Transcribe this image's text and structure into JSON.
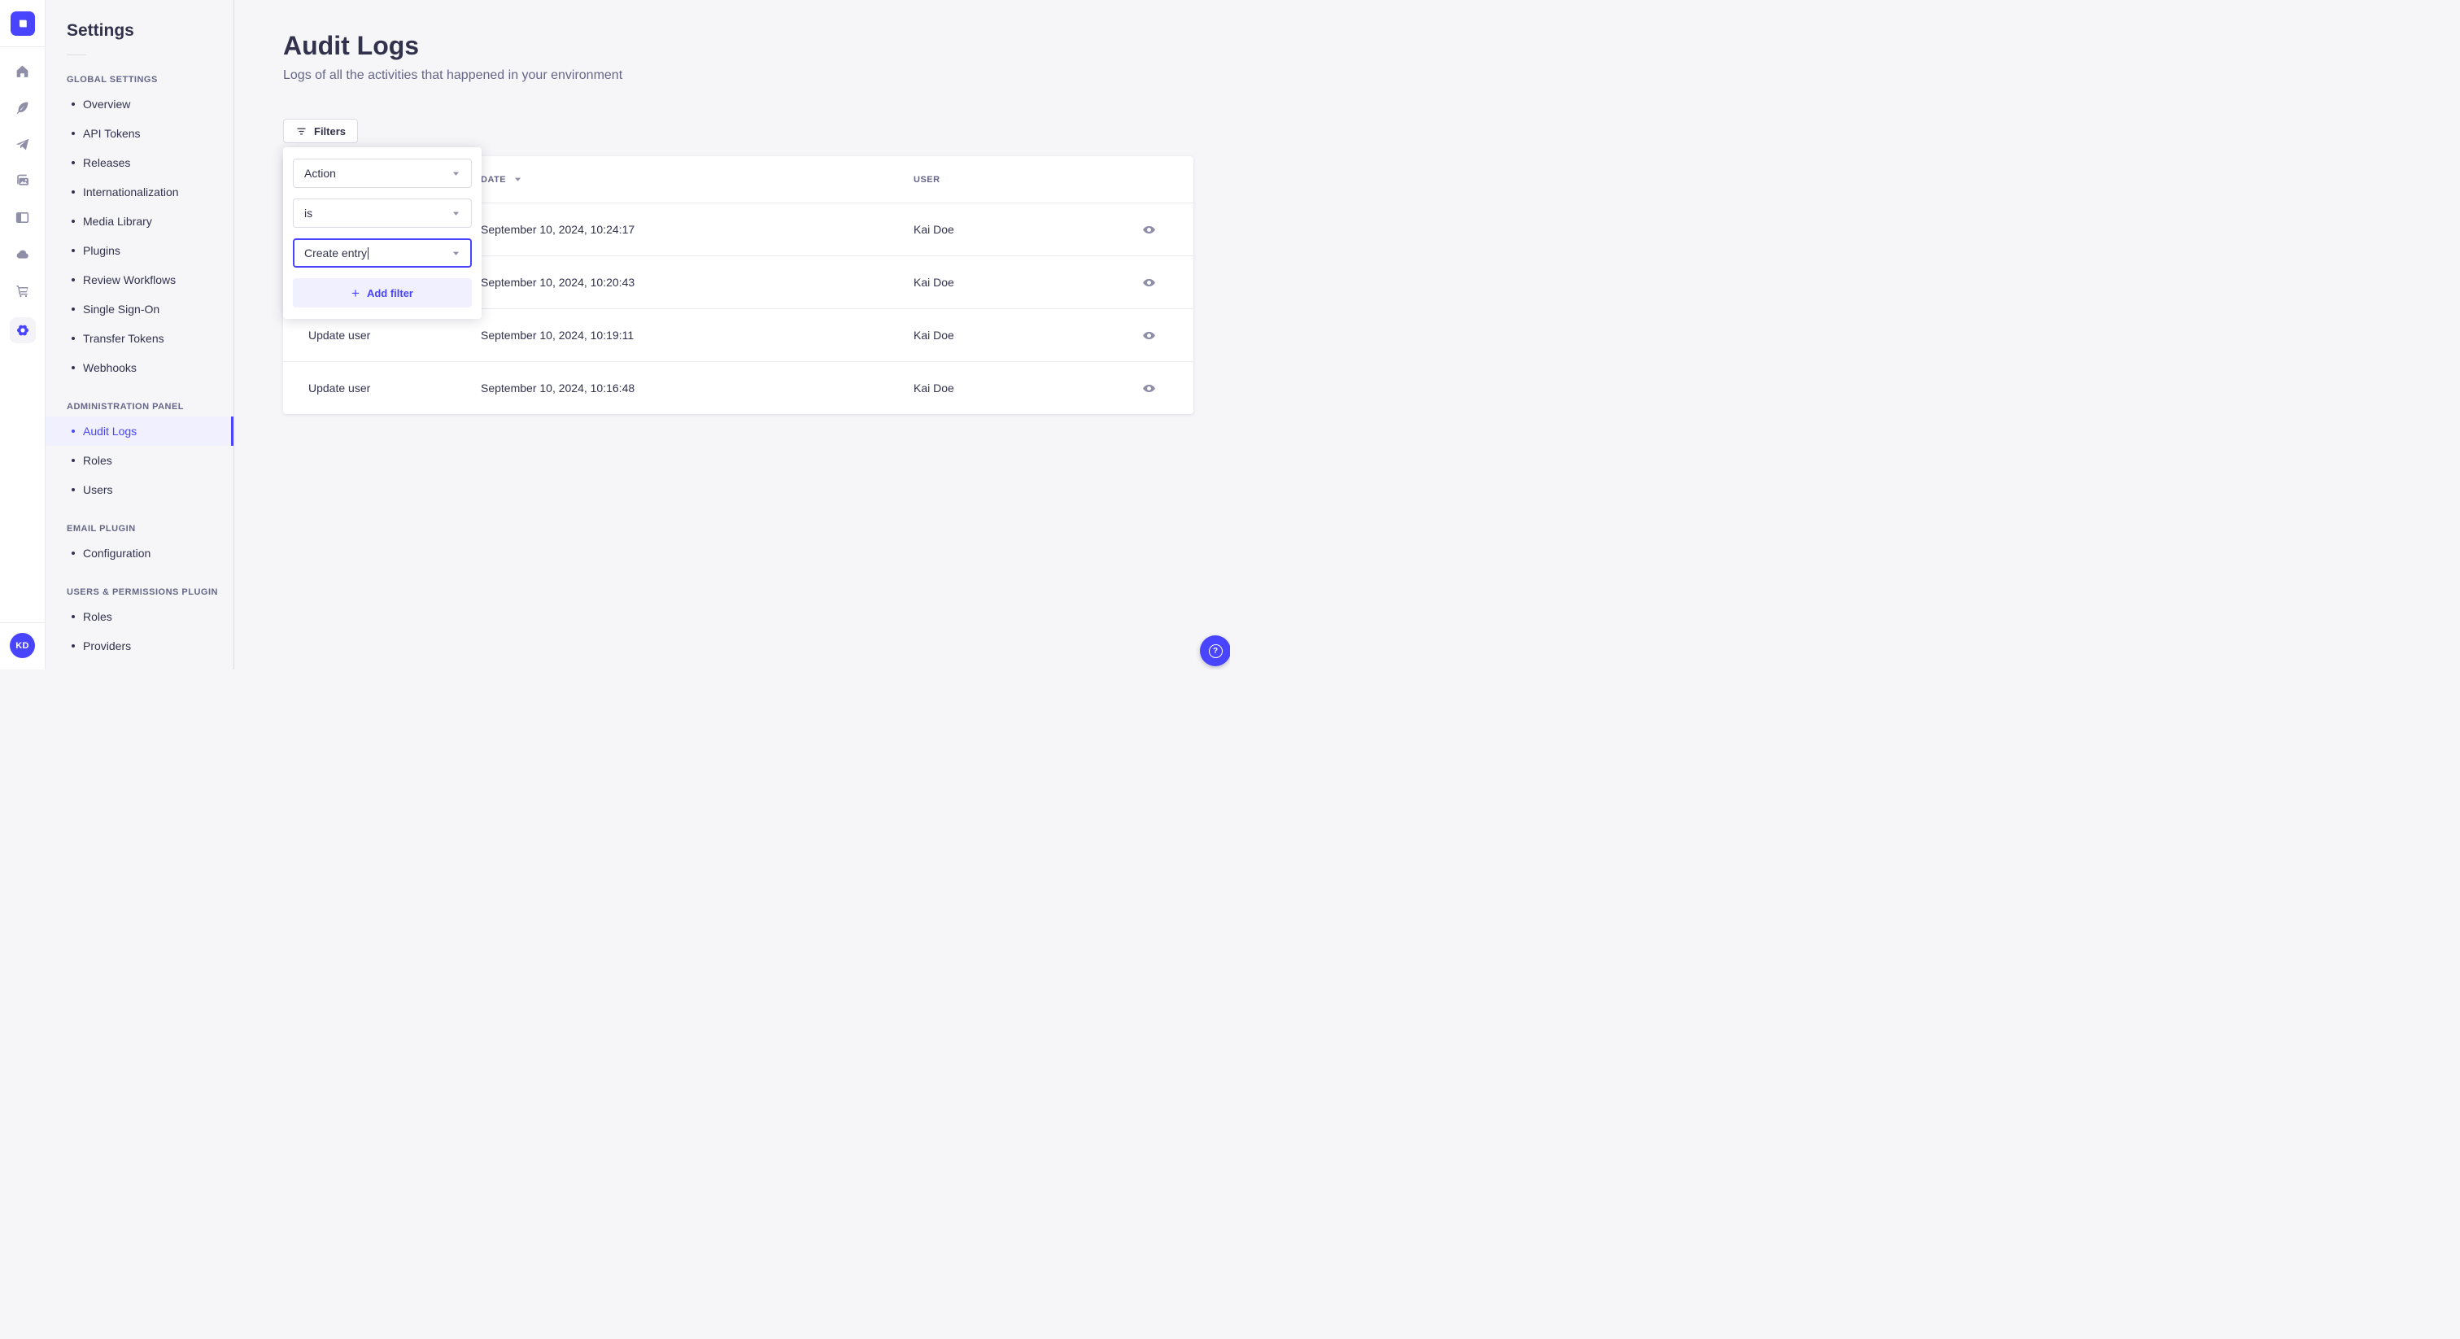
{
  "colors": {
    "accent": "#4945ff",
    "accent_light": "#f0f0ff",
    "text_dark": "#32324d",
    "text_muted": "#666687",
    "icon_gray": "#8e8ea9",
    "border": "#dcdce4",
    "background": "#f6f6f9"
  },
  "rail": {
    "logo_icon": "strapi-logo-icon",
    "icons": [
      "home-icon",
      "feather-icon",
      "send-icon",
      "media-icon",
      "layout-icon",
      "cloud-icon",
      "cart-icon",
      "gear-icon"
    ],
    "active_icon": "gear-icon",
    "avatar_initials": "KD"
  },
  "sidebar": {
    "title": "Settings",
    "sections": [
      {
        "label": "GLOBAL SETTINGS",
        "items": [
          {
            "label": "Overview"
          },
          {
            "label": "API Tokens"
          },
          {
            "label": "Releases"
          },
          {
            "label": "Internationalization"
          },
          {
            "label": "Media Library"
          },
          {
            "label": "Plugins"
          },
          {
            "label": "Review Workflows"
          },
          {
            "label": "Single Sign-On"
          },
          {
            "label": "Transfer Tokens"
          },
          {
            "label": "Webhooks"
          }
        ]
      },
      {
        "label": "ADMINISTRATION PANEL",
        "items": [
          {
            "label": "Audit Logs",
            "active": true
          },
          {
            "label": "Roles"
          },
          {
            "label": "Users"
          }
        ]
      },
      {
        "label": "EMAIL PLUGIN",
        "items": [
          {
            "label": "Configuration"
          }
        ]
      },
      {
        "label": "USERS & PERMISSIONS PLUGIN",
        "items": [
          {
            "label": "Roles"
          },
          {
            "label": "Providers"
          }
        ]
      }
    ]
  },
  "main": {
    "title": "Audit Logs",
    "subtitle": "Logs of all the activities that happened in your environment",
    "filters_button_label": "Filters",
    "filter_popover": {
      "field_select_value": "Action",
      "operator_select_value": "is",
      "value_select_value": "Create entry",
      "add_filter_label": "Add filter",
      "plus_glyph": "+"
    },
    "table": {
      "headers": {
        "action": "",
        "date": "DATE",
        "user": "USER"
      },
      "sort_column": "DATE",
      "sort_direction": "desc",
      "rows": [
        {
          "action": "",
          "date": "September 10, 2024, 10:24:17",
          "user": "Kai Doe"
        },
        {
          "action": "",
          "date": "September 10, 2024, 10:20:43",
          "user": "Kai Doe"
        },
        {
          "action": "Update user",
          "date": "September 10, 2024, 10:19:11",
          "user": "Kai Doe"
        },
        {
          "action": "Update user",
          "date": "September 10, 2024, 10:16:48",
          "user": "Kai Doe"
        }
      ]
    }
  },
  "help": {
    "icon": "question-mark-icon",
    "glyph": "?"
  }
}
